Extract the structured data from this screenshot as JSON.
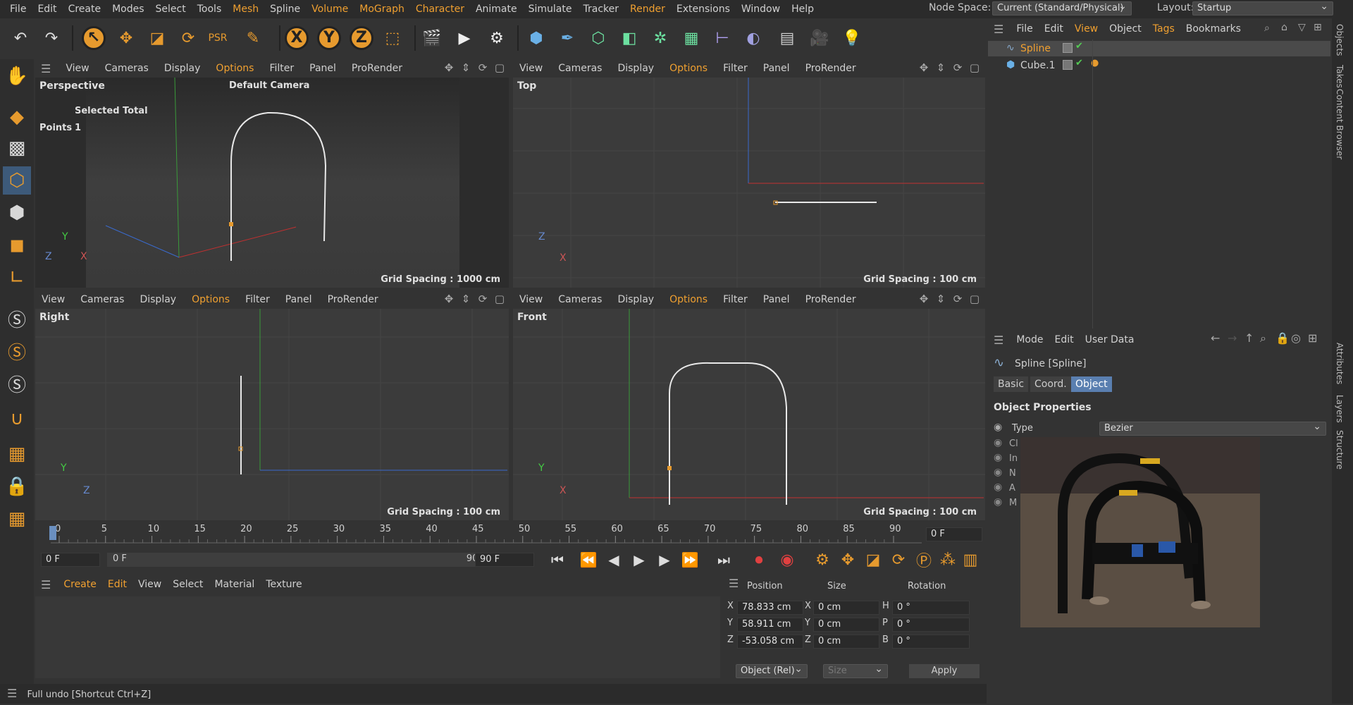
{
  "menu": [
    "File",
    "Edit",
    "Create",
    "Modes",
    "Select",
    "Tools",
    "Mesh",
    "Spline",
    "Volume",
    "MoGraph",
    "Character",
    "Animate",
    "Simulate",
    "Tracker",
    "Render",
    "Extensions",
    "Window",
    "Help"
  ],
  "menu_highlight": [
    "Mesh",
    "Volume",
    "MoGraph",
    "Character",
    "Render"
  ],
  "node_space_label": "Node Space:",
  "node_space_value": "Current (Standard/Physical)",
  "layout_label": "Layout:",
  "layout_value": "Startup",
  "viewport_menu": [
    "View",
    "Cameras",
    "Display",
    "Options",
    "Filter",
    "Panel",
    "ProRender"
  ],
  "viewports": {
    "perspective": {
      "label": "Perspective",
      "camera": "Default Camera",
      "grid": "Grid Spacing : 1000 cm",
      "hud_title": "Selected Total",
      "hud_row_label": "Points",
      "hud_row_value": "1"
    },
    "top": {
      "label": "Top",
      "grid": "Grid Spacing : 100 cm"
    },
    "right": {
      "label": "Right",
      "grid": "Grid Spacing : 100 cm"
    },
    "front": {
      "label": "Front",
      "grid": "Grid Spacing : 100 cm"
    }
  },
  "axis_letters": {
    "x": "X",
    "y": "Y",
    "z": "Z"
  },
  "timeline": {
    "ticks": [
      "0",
      "5",
      "10",
      "15",
      "20",
      "25",
      "30",
      "35",
      "40",
      "45",
      "50",
      "55",
      "60",
      "65",
      "70",
      "75",
      "80",
      "85",
      "90"
    ],
    "current_frame": "0 F",
    "start_field": "0 F",
    "range_start": "0 F",
    "range_end": "90 F",
    "end_field": "90 F"
  },
  "material_menu": [
    "Create",
    "Edit",
    "View",
    "Select",
    "Material",
    "Texture"
  ],
  "coord": {
    "headers": [
      "Position",
      "Size",
      "Rotation"
    ],
    "rows": [
      {
        "axis": "X",
        "pos": "78.833 cm",
        "size_axis": "X",
        "size": "0 cm",
        "rot_axis": "H",
        "rot": "0 °"
      },
      {
        "axis": "Y",
        "pos": "58.911 cm",
        "size_axis": "Y",
        "size": "0 cm",
        "rot_axis": "P",
        "rot": "0 °"
      },
      {
        "axis": "Z",
        "pos": "-53.058 cm",
        "size_axis": "Z",
        "size": "0 cm",
        "rot_axis": "B",
        "rot": "0 °"
      }
    ],
    "mode": "Object (Rel)",
    "size_mode": "Size",
    "apply": "Apply"
  },
  "status": "Full undo [Shortcut Ctrl+Z]",
  "objmgr": {
    "menu": [
      "File",
      "Edit",
      "View",
      "Object",
      "Tags",
      "Bookmarks"
    ],
    "objects": [
      {
        "name": "Spline",
        "selected": true
      },
      {
        "name": "Cube.1",
        "selected": false
      }
    ]
  },
  "attr": {
    "menu": [
      "Mode",
      "Edit",
      "User Data"
    ],
    "title": "Spline [Spline]",
    "tabs": [
      "Basic",
      "Coord.",
      "Object"
    ],
    "active_tab": "Object",
    "section": "Object Properties",
    "type_label": "Type",
    "type_value": "Bezier",
    "row_initials": [
      "Cl",
      "In",
      "N",
      "A",
      "M"
    ]
  },
  "rail_tabs": [
    "Objects",
    "Takes",
    "Content Browser",
    "Attributes",
    "Layers",
    "Structure"
  ],
  "colors": {
    "accent": "#f0a030",
    "select": "#5a7fb0",
    "bg": "#333333"
  }
}
